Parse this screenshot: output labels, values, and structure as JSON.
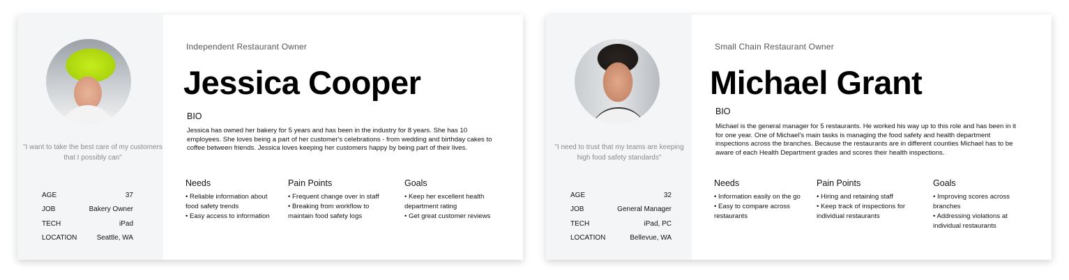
{
  "personas": [
    {
      "role": "Independent Restaurant Owner",
      "name": "Jessica Cooper",
      "quote": "\"I want to take the best care of my customers that I possibly can\"",
      "stats": [
        {
          "label": "AGE",
          "value": "37"
        },
        {
          "label": "JOB",
          "value": "Bakery Owner"
        },
        {
          "label": "TECH",
          "value": "iPad"
        },
        {
          "label": "LOCATION",
          "value": "Seattle, WA"
        }
      ],
      "bio_label": "BIO",
      "bio": "Jessica has owned her bakery for 5 years and has been in the industry for 8 years. She has 10 employees. She loves being a part of her customer's celebrations - from wedding and birthday cakes to coffee between friends. Jessica loves keeping her customers happy by being part of their lives.",
      "needs": {
        "title": "Needs",
        "items": [
          "• Reliable information about food safety trends",
          "• Easy access to information"
        ]
      },
      "pain_points": {
        "title": "Pain Points",
        "items": [
          "• Frequent change over in staff",
          "• Breaking from workflow to maintain food safety logs"
        ]
      },
      "goals": {
        "title": "Goals",
        "items": [
          "• Keep her excellent health department rating",
          "• Get great customer reviews"
        ]
      }
    },
    {
      "role": "Small Chain Restaurant Owner",
      "name": "Michael Grant",
      "quote": "\"I need to trust that my teams are keeping high food safety standards\"",
      "stats": [
        {
          "label": "AGE",
          "value": "32"
        },
        {
          "label": "JOB",
          "value": "General Manager"
        },
        {
          "label": "TECH",
          "value": "iPad, PC"
        },
        {
          "label": "LOCATION",
          "value": "Bellevue, WA"
        }
      ],
      "bio_label": "BIO",
      "bio": "Michael is the general manager for 5 restaurants. He worked his way up to this role and has been in it for one year. One of Michael's main tasks is managing the food safety and health department inspections across the branches. Because the restaurants are in different counties Michael has to be aware of each Health Department grades and scores their health inspections.",
      "needs": {
        "title": "Needs",
        "items": [
          "• Information easily on the go",
          "• Easy to compare across restaurants"
        ]
      },
      "pain_points": {
        "title": "Pain Points",
        "items": [
          "• Hiring and retaining staff",
          "• Keep track of inspections for individual restaurants"
        ]
      },
      "goals": {
        "title": "Goals",
        "items": [
          "• Improving scores across branches",
          "• Addressing violations at individual restaurants"
        ]
      }
    }
  ]
}
